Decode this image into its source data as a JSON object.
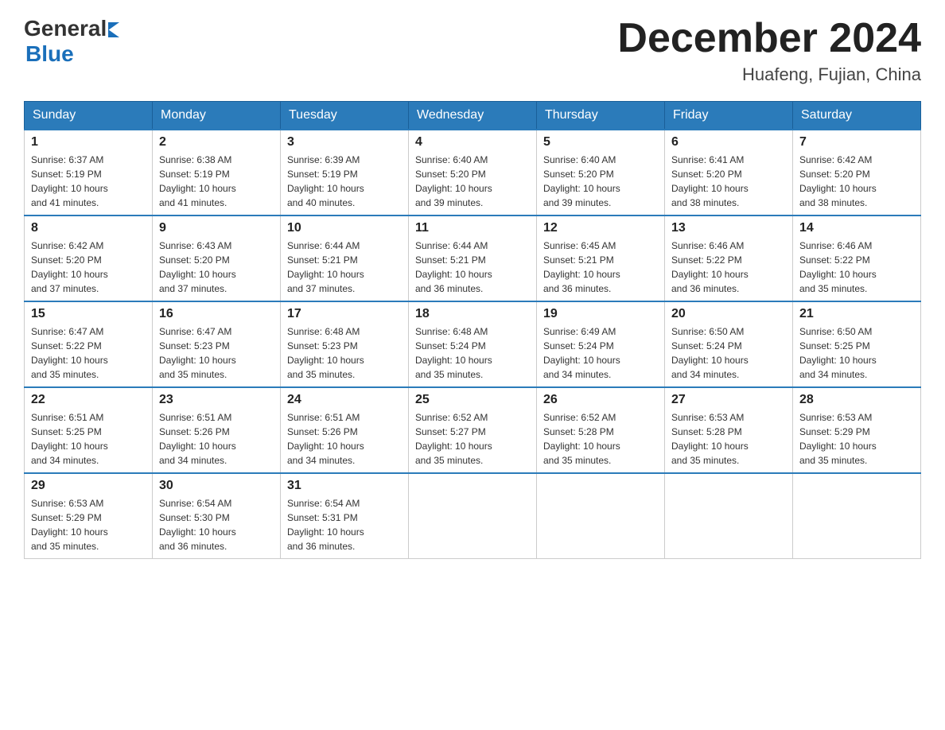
{
  "logo": {
    "text_general": "General",
    "text_blue": "Blue"
  },
  "title": {
    "month": "December 2024",
    "location": "Huafeng, Fujian, China"
  },
  "weekdays": [
    "Sunday",
    "Monday",
    "Tuesday",
    "Wednesday",
    "Thursday",
    "Friday",
    "Saturday"
  ],
  "weeks": [
    [
      {
        "day": "1",
        "sunrise": "6:37 AM",
        "sunset": "5:19 PM",
        "daylight": "10 hours and 41 minutes."
      },
      {
        "day": "2",
        "sunrise": "6:38 AM",
        "sunset": "5:19 PM",
        "daylight": "10 hours and 41 minutes."
      },
      {
        "day": "3",
        "sunrise": "6:39 AM",
        "sunset": "5:19 PM",
        "daylight": "10 hours and 40 minutes."
      },
      {
        "day": "4",
        "sunrise": "6:40 AM",
        "sunset": "5:20 PM",
        "daylight": "10 hours and 39 minutes."
      },
      {
        "day": "5",
        "sunrise": "6:40 AM",
        "sunset": "5:20 PM",
        "daylight": "10 hours and 39 minutes."
      },
      {
        "day": "6",
        "sunrise": "6:41 AM",
        "sunset": "5:20 PM",
        "daylight": "10 hours and 38 minutes."
      },
      {
        "day": "7",
        "sunrise": "6:42 AM",
        "sunset": "5:20 PM",
        "daylight": "10 hours and 38 minutes."
      }
    ],
    [
      {
        "day": "8",
        "sunrise": "6:42 AM",
        "sunset": "5:20 PM",
        "daylight": "10 hours and 37 minutes."
      },
      {
        "day": "9",
        "sunrise": "6:43 AM",
        "sunset": "5:20 PM",
        "daylight": "10 hours and 37 minutes."
      },
      {
        "day": "10",
        "sunrise": "6:44 AM",
        "sunset": "5:21 PM",
        "daylight": "10 hours and 37 minutes."
      },
      {
        "day": "11",
        "sunrise": "6:44 AM",
        "sunset": "5:21 PM",
        "daylight": "10 hours and 36 minutes."
      },
      {
        "day": "12",
        "sunrise": "6:45 AM",
        "sunset": "5:21 PM",
        "daylight": "10 hours and 36 minutes."
      },
      {
        "day": "13",
        "sunrise": "6:46 AM",
        "sunset": "5:22 PM",
        "daylight": "10 hours and 36 minutes."
      },
      {
        "day": "14",
        "sunrise": "6:46 AM",
        "sunset": "5:22 PM",
        "daylight": "10 hours and 35 minutes."
      }
    ],
    [
      {
        "day": "15",
        "sunrise": "6:47 AM",
        "sunset": "5:22 PM",
        "daylight": "10 hours and 35 minutes."
      },
      {
        "day": "16",
        "sunrise": "6:47 AM",
        "sunset": "5:23 PM",
        "daylight": "10 hours and 35 minutes."
      },
      {
        "day": "17",
        "sunrise": "6:48 AM",
        "sunset": "5:23 PM",
        "daylight": "10 hours and 35 minutes."
      },
      {
        "day": "18",
        "sunrise": "6:48 AM",
        "sunset": "5:24 PM",
        "daylight": "10 hours and 35 minutes."
      },
      {
        "day": "19",
        "sunrise": "6:49 AM",
        "sunset": "5:24 PM",
        "daylight": "10 hours and 34 minutes."
      },
      {
        "day": "20",
        "sunrise": "6:50 AM",
        "sunset": "5:24 PM",
        "daylight": "10 hours and 34 minutes."
      },
      {
        "day": "21",
        "sunrise": "6:50 AM",
        "sunset": "5:25 PM",
        "daylight": "10 hours and 34 minutes."
      }
    ],
    [
      {
        "day": "22",
        "sunrise": "6:51 AM",
        "sunset": "5:25 PM",
        "daylight": "10 hours and 34 minutes."
      },
      {
        "day": "23",
        "sunrise": "6:51 AM",
        "sunset": "5:26 PM",
        "daylight": "10 hours and 34 minutes."
      },
      {
        "day": "24",
        "sunrise": "6:51 AM",
        "sunset": "5:26 PM",
        "daylight": "10 hours and 34 minutes."
      },
      {
        "day": "25",
        "sunrise": "6:52 AM",
        "sunset": "5:27 PM",
        "daylight": "10 hours and 35 minutes."
      },
      {
        "day": "26",
        "sunrise": "6:52 AM",
        "sunset": "5:28 PM",
        "daylight": "10 hours and 35 minutes."
      },
      {
        "day": "27",
        "sunrise": "6:53 AM",
        "sunset": "5:28 PM",
        "daylight": "10 hours and 35 minutes."
      },
      {
        "day": "28",
        "sunrise": "6:53 AM",
        "sunset": "5:29 PM",
        "daylight": "10 hours and 35 minutes."
      }
    ],
    [
      {
        "day": "29",
        "sunrise": "6:53 AM",
        "sunset": "5:29 PM",
        "daylight": "10 hours and 35 minutes."
      },
      {
        "day": "30",
        "sunrise": "6:54 AM",
        "sunset": "5:30 PM",
        "daylight": "10 hours and 36 minutes."
      },
      {
        "day": "31",
        "sunrise": "6:54 AM",
        "sunset": "5:31 PM",
        "daylight": "10 hours and 36 minutes."
      },
      null,
      null,
      null,
      null
    ]
  ],
  "labels": {
    "sunrise": "Sunrise: ",
    "sunset": "Sunset: ",
    "daylight": "Daylight: "
  }
}
